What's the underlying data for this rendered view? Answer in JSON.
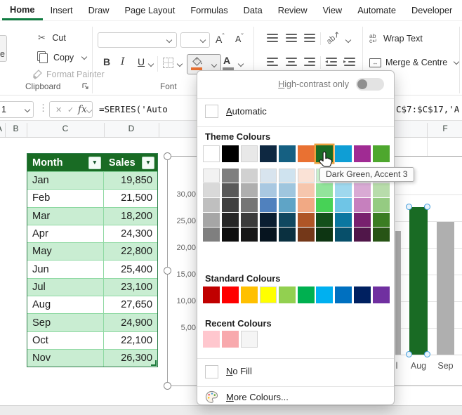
{
  "ribbon": {
    "tabs": [
      {
        "label": "Home",
        "active": true
      },
      {
        "label": "Insert"
      },
      {
        "label": "Draw"
      },
      {
        "label": "Page Layout"
      },
      {
        "label": "Formulas"
      },
      {
        "label": "Data"
      },
      {
        "label": "Review"
      },
      {
        "label": "View"
      },
      {
        "label": "Automate"
      },
      {
        "label": "Developer"
      }
    ],
    "clipboard": {
      "cut": "Cut",
      "copy": "Copy",
      "format_painter": "Format Painter",
      "group_label": "Clipboard",
      "paste_fragment": "e"
    },
    "font": {
      "group_label": "Font",
      "bold": "B",
      "italic": "I",
      "underline": "U"
    },
    "wrap_text": "Wrap Text",
    "merge_centre": "Merge & Centre"
  },
  "formula_bar": {
    "name_box": "1",
    "cancel": "✕",
    "enter": "✓",
    "fx": "fx",
    "formula_left": "=SERIES('Auto",
    "formula_right": "C$7:$C$17,'A"
  },
  "sheet": {
    "col_a": "A",
    "col_b": "B",
    "col_c": "C",
    "col_d": "D",
    "col_f": "F"
  },
  "table": {
    "header_month": "Month",
    "header_sales": "Sales",
    "rows": [
      [
        "Jan",
        "19,850"
      ],
      [
        "Feb",
        "21,500"
      ],
      [
        "Mar",
        "18,200"
      ],
      [
        "Apr",
        "24,300"
      ],
      [
        "May",
        "22,800"
      ],
      [
        "Jun",
        "25,400"
      ],
      [
        "Jul",
        "23,100"
      ],
      [
        "Aug",
        "27,650"
      ],
      [
        "Sep",
        "24,900"
      ],
      [
        "Oct",
        "22,100"
      ],
      [
        "Nov",
        "26,300"
      ]
    ]
  },
  "chart": {
    "ticks": [
      "30,00",
      "25,00",
      "20,00",
      "15,00",
      "10,00",
      "5,00"
    ],
    "visible": [
      {
        "label": "Jul",
        "clip_label": "l",
        "value": 23100
      },
      {
        "label": "Aug",
        "value": 27650,
        "selected": true
      },
      {
        "label": "Sep",
        "value": 24900
      }
    ],
    "bar_gray": "#AFAFAF",
    "bar_green": "#196B24"
  },
  "chart_data": {
    "type": "bar",
    "categories": [
      "Jan",
      "Feb",
      "Mar",
      "Apr",
      "May",
      "Jun",
      "Jul",
      "Aug",
      "Sep",
      "Oct",
      "Nov"
    ],
    "values": [
      19850,
      21500,
      18200,
      24300,
      22800,
      25400,
      23100,
      27650,
      24900,
      22100,
      26300
    ],
    "title": "",
    "xlabel": "",
    "ylabel": "",
    "ylim": [
      0,
      30000
    ],
    "gridlines": true,
    "visible_categories": [
      "Jul",
      "Aug",
      "Sep"
    ],
    "selected_bar": "Aug"
  },
  "color_picker": {
    "high_contrast": "High-contrast only",
    "automatic": "Automatic",
    "theme_title": "Theme Colours",
    "standard_title": "Standard Colours",
    "recent_title": "Recent Colours",
    "no_fill": "No Fill",
    "more_colours": "More Colours...",
    "tooltip": "Dark Green, Accent 3",
    "highlight_index": 6,
    "highlight_ring": "#EBA13F",
    "theme_colors": [
      "#FFFFFF",
      "#000000",
      "#E8E8E8",
      "#0E2841",
      "#156082",
      "#E97132",
      "#196B24",
      "#0F9ED5",
      "#A02B93",
      "#4EA72E"
    ],
    "variants": [
      [
        "#F2F2F2",
        "#7F7F7F",
        "#D1D1D1",
        "#D8E4EE",
        "#CFE3EF",
        "#FAE2D6",
        "#C8F0CC",
        "#CFECF7",
        "#ECD5E9",
        "#DCEDD5"
      ],
      [
        "#D9D9D9",
        "#595959",
        "#AFAFAF",
        "#A9C8E1",
        "#9FC6DE",
        "#F6C6AD",
        "#92E49B",
        "#9FD8EE",
        "#D9AAD4",
        "#B8DCAB"
      ],
      [
        "#BFBFBF",
        "#404040",
        "#757575",
        "#5081BE",
        "#5FA4C6",
        "#F1A984",
        "#47D256",
        "#6FC5E6",
        "#C680BE",
        "#95CB82"
      ],
      [
        "#A6A6A6",
        "#262626",
        "#3B3B3B",
        "#0A1E31",
        "#104860",
        "#AF5526",
        "#13501B",
        "#0B77A0",
        "#78206E",
        "#3B7D23"
      ],
      [
        "#7F7F7F",
        "#0D0D0D",
        "#161616",
        "#06141F",
        "#0A3040",
        "#743819",
        "#0D3512",
        "#074F6A",
        "#501649",
        "#275415"
      ]
    ],
    "standard_colors": [
      "#C00000",
      "#FF0000",
      "#FFC000",
      "#FFFF00",
      "#92D050",
      "#00B050",
      "#00B0F0",
      "#0070C0",
      "#002060",
      "#7030A0"
    ],
    "recent_colors": [
      "#FFC7CE",
      "#F8A9AD",
      "#F5F5F5"
    ]
  }
}
